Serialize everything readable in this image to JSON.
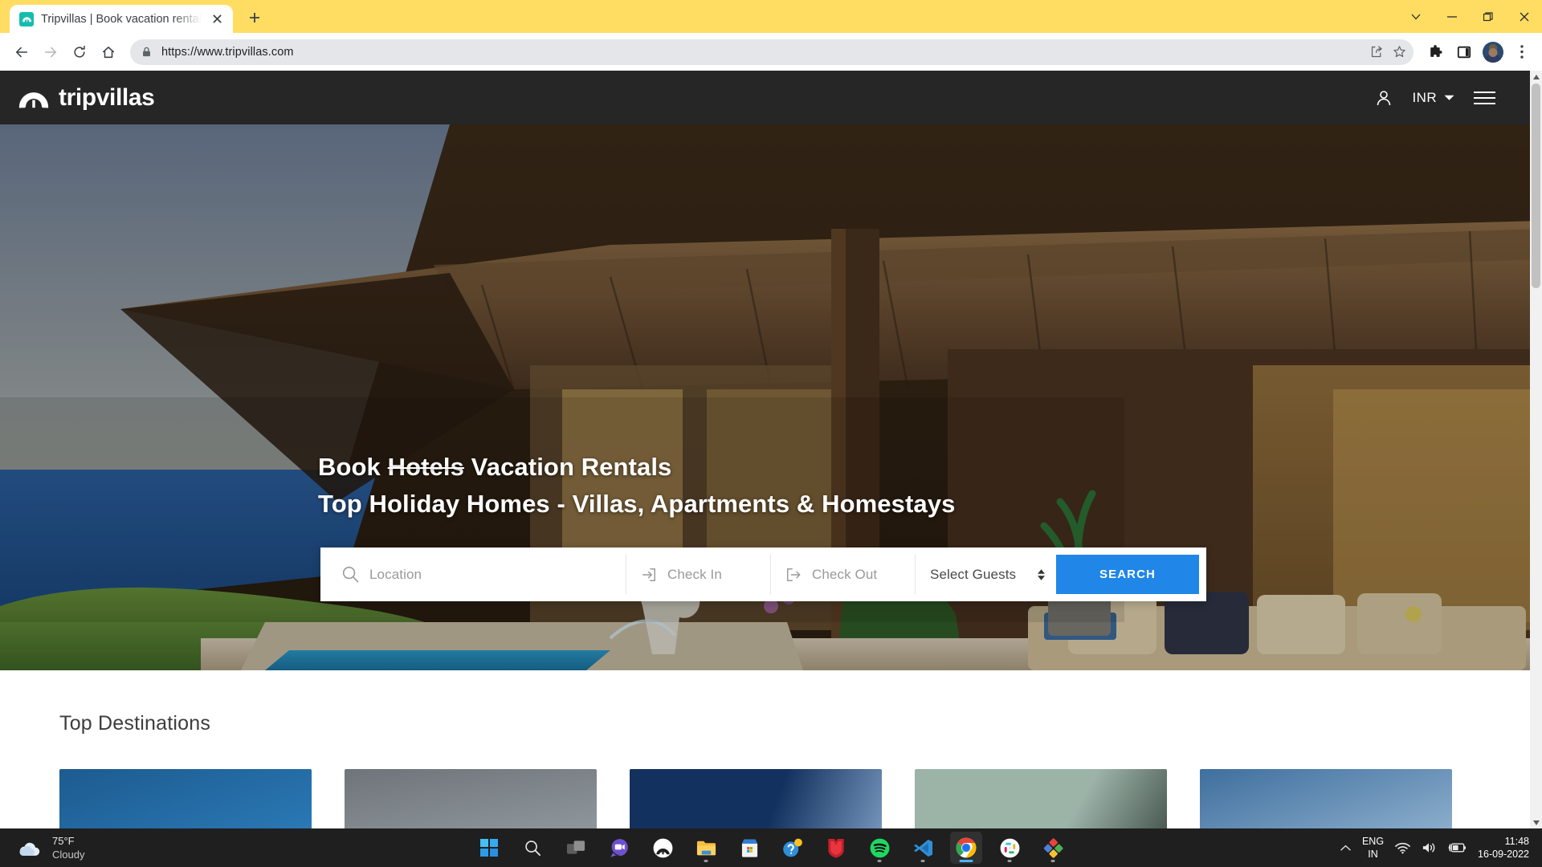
{
  "browser": {
    "tab": {
      "title": "Tripvillas | Book vacation rentals,",
      "favicon_name": "tripvillas-favicon"
    },
    "new_tab_label": "+",
    "window_controls": [
      {
        "name": "tab-search-button",
        "glyph": "chevron-down"
      },
      {
        "name": "minimize-button",
        "glyph": "minimize"
      },
      {
        "name": "maximize-button",
        "glyph": "restore"
      },
      {
        "name": "close-window-button",
        "glyph": "close"
      }
    ],
    "nav": {
      "back": "back-arrow",
      "forward": "forward-arrow",
      "reload": "reload",
      "home": "home"
    },
    "omnibox": {
      "url": "https://www.tripvillas.com",
      "lock": "site-lock-icon",
      "share": "share-icon",
      "bookmark": "bookmark-star-icon"
    },
    "toolbar_right": [
      "extensions-puzzle-icon",
      "side-panel-icon",
      "profile-avatar",
      "chrome-menu-icon"
    ],
    "theme_color": "#ffdd63"
  },
  "site": {
    "logo_text": "tripvillas",
    "currency": "INR",
    "header": {
      "account_icon": "user-icon",
      "menu_icon": "hamburger-menu-icon",
      "background": "#262626"
    },
    "hero": {
      "headline_line1_prefix": "Book ",
      "headline_line1_strike": "Hotels",
      "headline_line1_suffix": " Vacation Rentals",
      "headline_line2": "Top Holiday Homes - Villas, Apartments & Homestays"
    },
    "search": {
      "location_placeholder": "Location",
      "checkin_placeholder": "Check In",
      "checkout_placeholder": "Check Out",
      "guests_value": "Select Guests",
      "search_button": "SEARCH",
      "accent_color": "#2086e8",
      "icons": {
        "location": "search-icon",
        "checkin": "login-arrow-icon",
        "checkout": "logout-arrow-icon",
        "guests": "stepper-arrows-icon"
      }
    },
    "destinations": {
      "title": "Top Destinations",
      "cards": [
        {
          "name": "destination-card-1",
          "top": "#1d5b8f",
          "bottom": "#2d7fbe"
        },
        {
          "name": "destination-card-2",
          "top": "#6e747a",
          "bottom": "#8f969c"
        },
        {
          "name": "destination-card-3",
          "top": "#12315e",
          "bottom": "#27589a"
        },
        {
          "name": "destination-card-4",
          "top": "#8aa79c",
          "bottom": "#4c5a52"
        },
        {
          "name": "destination-card-5",
          "top": "#3f6f9e",
          "bottom": "#7ca4c9"
        }
      ]
    }
  },
  "taskbar": {
    "weather": {
      "temperature": "75°F",
      "condition": "Cloudy",
      "icon": "cloud-icon"
    },
    "apps": [
      {
        "name": "start-button",
        "icon": "windows-logo"
      },
      {
        "name": "search-taskbar-button",
        "icon": "search-icon"
      },
      {
        "name": "task-view-button",
        "icon": "task-view-icon"
      },
      {
        "name": "chat-teams-button",
        "icon": "teams-chat-icon"
      },
      {
        "name": "app-white-circle-button",
        "icon": "arch-circle-icon"
      },
      {
        "name": "file-explorer-button",
        "icon": "folder-icon"
      },
      {
        "name": "microsoft-store-button",
        "icon": "store-icon"
      },
      {
        "name": "get-help-button",
        "icon": "help-icon"
      },
      {
        "name": "mcafee-button",
        "icon": "mcafee-shield-icon"
      },
      {
        "name": "spotify-button",
        "icon": "spotify-icon"
      },
      {
        "name": "vscode-button",
        "icon": "vscode-icon"
      },
      {
        "name": "chrome-button",
        "icon": "chrome-icon"
      },
      {
        "name": "slack-button",
        "icon": "slack-icon"
      },
      {
        "name": "photos-button",
        "icon": "diamond-app-icon"
      }
    ],
    "tray": {
      "overflow": "chevron-up-icon",
      "language_line1": "ENG",
      "language_line2": "IN",
      "wifi": "wifi-icon",
      "volume": "speaker-icon",
      "battery": "battery-charging-icon",
      "time": "11:48",
      "date": "16-09-2022"
    }
  }
}
